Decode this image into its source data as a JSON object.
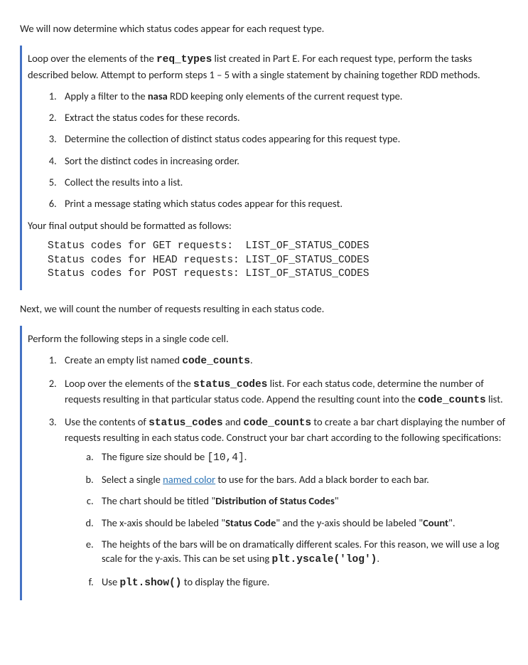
{
  "intro1": "We will now determine which status codes appear for each request type.",
  "box1": {
    "intro_a": "Loop over the elements of the ",
    "intro_b": "req_types",
    "intro_c": " list created in Part E. For each request type, perform the tasks described below. Attempt to perform steps 1 – 5 with a single statement by chaining together RDD methods.",
    "items": {
      "i1a": "Apply a filter to the ",
      "i1b": "nasa",
      "i1c": " RDD keeping only elements of the current request type.",
      "i2": "Extract the status codes for these records.",
      "i3": "Determine the collection of distinct status codes appearing for this request type.",
      "i4": "Sort the distinct codes in increasing order.",
      "i5": "Collect the results into a list.",
      "i6": "Print a message stating which status codes appear for this request."
    },
    "outro": "Your final output should be formatted as follows:",
    "code": "Status codes for GET requests:  LIST_OF_STATUS_CODES\nStatus codes for HEAD requests: LIST_OF_STATUS_CODES\nStatus codes for POST requests: LIST_OF_STATUS_CODES"
  },
  "intro2": "Next, we will count the number of requests resulting in each status code.",
  "box2": {
    "intro": "Perform the following steps in a single code cell.",
    "items": {
      "i1a": "Create an empty list named ",
      "i1b": "code_counts",
      "i1c": ".",
      "i2a": "Loop over the elements of the ",
      "i2b": "status_codes",
      "i2c": " list. For each status code, determine the number of requests resulting in that particular status code. Append the resulting count into the ",
      "i2d": "code_counts",
      "i2e": " list.",
      "i3a": "Use the contents of ",
      "i3b": "status_codes",
      "i3c": " and ",
      "i3d": "code_counts",
      "i3e": " to create a bar chart displaying the number of requests resulting in each status code. Construct your bar chart according to the following specifications:",
      "sub": {
        "a1": "The figure size should be ",
        "a2": "[10,4]",
        "a3": ".",
        "b1": "Select a single ",
        "b2": "named color",
        "b3": " to use for the bars. Add a black border to each bar.",
        "c1": "The chart should be titled \"",
        "c2": "Distribution of Status Codes",
        "c3": "\"",
        "d1": "The x-axis should be labeled \"",
        "d2": "Status Code",
        "d3": "\" and the y-axis should be labeled \"",
        "d4": "Count",
        "d5": "\".",
        "e1": "The heights of the bars will be on dramatically different scales. For this reason, we will use a log scale for the y-axis. This can be set using ",
        "e2": "plt.yscale('log')",
        "e3": ".",
        "f1": "Use ",
        "f2": "plt.show()",
        "f3": " to display the figure."
      }
    }
  }
}
